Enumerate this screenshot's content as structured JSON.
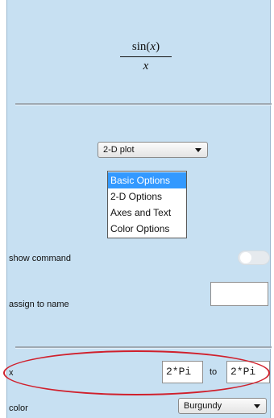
{
  "formula": {
    "numerator_fn": "sin",
    "numerator_arg": "x",
    "denominator": "x"
  },
  "plot_type_select": {
    "value": "2-D plot"
  },
  "options_list": {
    "items": [
      {
        "label": "Basic Options"
      },
      {
        "label": "2-D Options"
      },
      {
        "label": "Axes and Text"
      },
      {
        "label": "Color Options"
      }
    ],
    "selected": "Basic Options"
  },
  "show_command": {
    "label": "show command",
    "on": false
  },
  "assign_to_name": {
    "label": "assign to name",
    "value": ""
  },
  "range": {
    "variable": "x",
    "from": "2*Pi",
    "to_label": "to",
    "to": "2*Pi"
  },
  "color": {
    "label": "color",
    "value": "Burgundy"
  },
  "colors": {
    "panel": "#c7e0f2",
    "selection": "#3399ff",
    "highlight_ring": "#d0202c"
  },
  "icons": {
    "dropdown": "chevron-down-icon",
    "toggle": "toggle-switch"
  }
}
